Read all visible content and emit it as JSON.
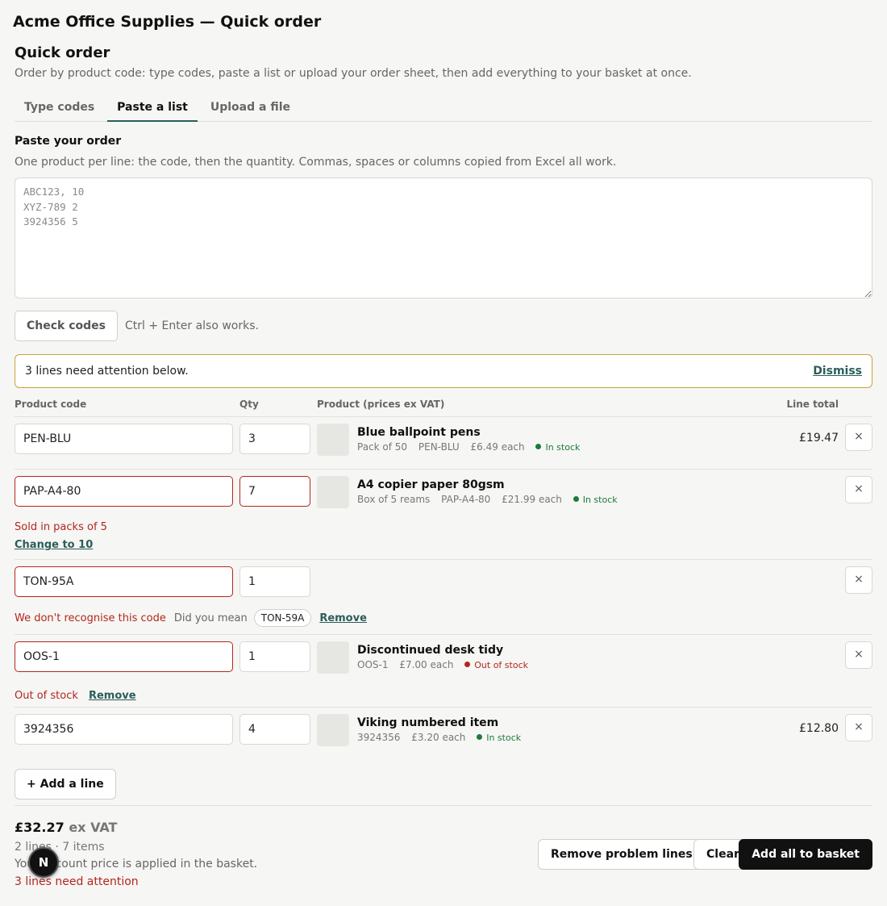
{
  "app": {
    "title": "Acme Office Supplies — Quick order"
  },
  "page": {
    "title": "Quick order",
    "subtitle": "Order by product code: type codes, paste a list or upload your order sheet, then add everything to your basket at once."
  },
  "tabs": [
    {
      "label": "Type codes",
      "active": false
    },
    {
      "label": "Paste a list",
      "active": true
    },
    {
      "label": "Upload a file",
      "active": false
    }
  ],
  "paste": {
    "label": "Paste your order",
    "help": "One product per line: the code, then the quantity. Commas, spaces or columns copied from Excel all work.",
    "placeholder": "ABC123, 10\nXYZ-789 2\n3924356 5",
    "value": ""
  },
  "check": {
    "button_label": "Check codes",
    "hint": "Ctrl + Enter also works."
  },
  "alert": {
    "text": "3 lines need attention below.",
    "dismiss_label": "Dismiss",
    "border_color": "#c9a23c"
  },
  "table": {
    "headers": {
      "code": "Product code",
      "qty": "Qty",
      "product": "Product (prices ex VAT)",
      "total": "Line total"
    },
    "rows": [
      {
        "code": "PEN-BLU",
        "qty": "3",
        "name": "Blue ballpoint pens",
        "pack": "Pack of 50",
        "sku": "PEN-BLU",
        "price": "£6.49 each",
        "stock": "In stock",
        "line_total": "£19.47",
        "remove_label": "×"
      },
      {
        "code": "PAP-A4-80",
        "qty": "7",
        "name": "A4 copier paper 80gsm",
        "pack": "Box of 5 reams",
        "sku": "PAP-A4-80",
        "price": "£21.99 each",
        "stock": "In stock",
        "line_total": "",
        "remove_label": "×",
        "error": "Sold in packs of 5",
        "fix_label": "Change to 10"
      },
      {
        "code": "TON-95A",
        "qty": "1",
        "remove_label": "×",
        "error": "We don't recognise this code",
        "suggest_prompt": "Did you mean",
        "suggestion": "TON-59A",
        "remove_link_label": "Remove"
      },
      {
        "code": "OOS-1",
        "qty": "1",
        "name": "Discontinued desk tidy",
        "sku": "OOS-1",
        "price": "£7.00 each",
        "stock": "Out of stock",
        "remove_label": "×",
        "error": "Out of stock",
        "remove_link_label": "Remove"
      },
      {
        "code": "3924356",
        "qty": "4",
        "name": "Viking numbered item",
        "sku": "3924356",
        "price": "£3.20 each",
        "stock": "In stock",
        "line_total": "£12.80",
        "remove_label": "×"
      }
    ]
  },
  "add_line_label": "+ Add a line",
  "summary": {
    "total": "£32.27",
    "total_suffix": "ex VAT",
    "count": "2 lines · 7 items",
    "note": "Your account price is applied in the basket.",
    "attention": "3 lines need attention"
  },
  "actions": {
    "remove_problem_label": "Remove problem lines",
    "clear_label": "Clear",
    "add_all_label": "Add all to basket"
  },
  "badge": {
    "letter": "N"
  },
  "colors": {
    "accent": "#2b5d5a",
    "error": "#b3261e",
    "success": "#1d7a3c",
    "primary_button": "#111111"
  }
}
